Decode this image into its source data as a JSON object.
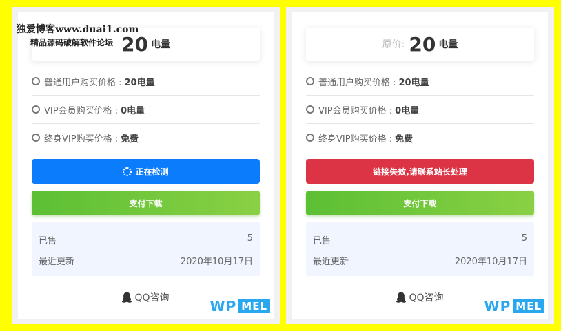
{
  "watermark": {
    "line1": "独爱博客www.duai1.com",
    "line2": "精品源码破解软件论坛"
  },
  "left": {
    "price": {
      "value": "20",
      "unit": "电量"
    },
    "rows": [
      {
        "label": "普通用户购买价格 :",
        "value": "20电量"
      },
      {
        "label": "VIP会员购买价格 :",
        "value": "0电量"
      },
      {
        "label": "终身VIP购买价格 :",
        "value": "免费"
      }
    ],
    "status_button": "正在检测",
    "pay_button": "支付下载",
    "info": {
      "sold_label": "已售",
      "sold_value": "5",
      "updated_label": "最近更新",
      "updated_value": "2020年10月17日"
    },
    "qq": "QQ咨询",
    "logo": {
      "wp": "WP",
      "mel": "MEL"
    }
  },
  "right": {
    "price": {
      "label": "原价:",
      "value": "20",
      "unit": "电量"
    },
    "rows": [
      {
        "label": "普通用户购买价格 :",
        "value": "20电量"
      },
      {
        "label": "VIP会员购买价格 :",
        "value": "0电量"
      },
      {
        "label": "终身VIP购买价格 :",
        "value": "免费"
      }
    ],
    "status_button": "链接失效,请联系站长处理",
    "pay_button": "支付下载",
    "info": {
      "sold_label": "已售",
      "sold_value": "5",
      "updated_label": "最近更新",
      "updated_value": "2020年10月17日"
    },
    "qq": "QQ咨询",
    "logo": {
      "wp": "WP",
      "mel": "MEL"
    }
  },
  "colors": {
    "background": "#ffff00",
    "blue_button": "#0b7cfb",
    "red_button": "#dc3444",
    "green_button": "#6cc43a",
    "logo": "#2aa8ef"
  },
  "icons": [
    "spinner-icon",
    "qq-penguin-icon",
    "radio-ring-icon"
  ]
}
